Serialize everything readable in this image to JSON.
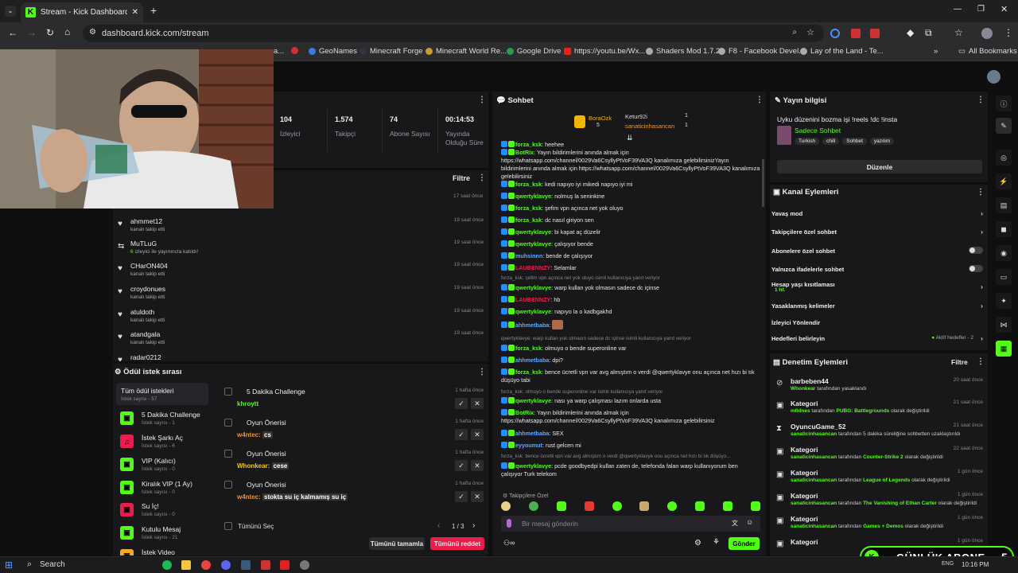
{
  "browser": {
    "tab_title": "Stream - Kick Dashboard",
    "url": "dashboard.kick.com/stream",
    "bookmarks": [
      "a...",
      "GeoNames",
      "Minecraft Forge",
      "Minecraft World Re...",
      "Google Drive",
      "https://youtu.be/Wx...",
      "Shaders Mod 1.7.2",
      "F8 - Facebook Devel...",
      "Lay of the Land - Te..."
    ],
    "all_bookmarks": "All Bookmarks"
  },
  "stats": [
    {
      "value": "104",
      "label": "İzleyici"
    },
    {
      "value": "1.574",
      "label": "Takipçi"
    },
    {
      "value": "74",
      "label": "Abone Sayısı"
    },
    {
      "value": "00:14:53",
      "label": "Yayında Olduğu Süre"
    }
  ],
  "activity": {
    "filter_label": "Filtre",
    "first_time": "17 saat önce",
    "items": [
      {
        "name": "ahmmet12",
        "desc": "kanalı takip etti",
        "time": "19 saat önce",
        "icon": "heart-icon"
      },
      {
        "name": "MuTLuG",
        "desc_count": "6",
        "desc": "izleyici ile yayınınıza katıldı!",
        "time": "19 saat önce",
        "icon": "raid-icon"
      },
      {
        "name": "CHarON404",
        "desc": "kanalı takip etti",
        "time": "19 saat önce",
        "icon": "heart-icon"
      },
      {
        "name": "croydonues",
        "desc": "kanalı takip etti",
        "time": "19 saat önce",
        "icon": "heart-icon"
      },
      {
        "name": "atuldoth",
        "desc": "kanalı takip etti",
        "time": "19 saat önce",
        "icon": "heart-icon"
      },
      {
        "name": "atandgala",
        "desc": "kanalı takip etti",
        "time": "19 saat önce",
        "icon": "heart-icon"
      },
      {
        "name": "radar0212",
        "desc": "",
        "time": "19 saat önce",
        "icon": "heart-icon"
      }
    ]
  },
  "rewards": {
    "title": "Ödül istek sırası",
    "categories": [
      {
        "label": "Tüm ödül istekleri",
        "count": "İstek sayısı - 57"
      },
      {
        "label": "5 Dakika Challenge",
        "count": "İstek sayısı - 1"
      },
      {
        "label": "İstek Şarkı Aç",
        "count": "İstek sayısı - 6"
      },
      {
        "label": "VIP (Kalıcı)",
        "count": "İstek sayısı - 0"
      },
      {
        "label": "Kiralık VIP (1 Ay)",
        "count": "İstek sayısı - 0"
      },
      {
        "label": "Su İç!",
        "count": "İstek sayısı - 0"
      },
      {
        "label": "Kutulu Mesaj",
        "count": "İstek sayısı - 21"
      },
      {
        "label": "İstek Video",
        "count": ""
      }
    ],
    "requests": [
      {
        "title": "5 Dakika Challenge",
        "user": "khroytt",
        "text": "",
        "time": "1 hafta önce"
      },
      {
        "title": "Oyun Önerisi",
        "user": "w4ntec",
        "text": "cs",
        "time": "1 hafta önce"
      },
      {
        "title": "Oyun Önerisi",
        "user": "Whonkear",
        "text": "cese",
        "time": "1 hafta önce"
      },
      {
        "title": "Oyun Önerisi",
        "user": "w4ntec",
        "text": "stokta su iç kalmamış su iç",
        "time": "1 hafta önce"
      }
    ],
    "select_all": "Tümünü Seç",
    "page": "1 / 3",
    "approve_all": "Tümünü tamamla",
    "reject_all": "Tümünü reddet"
  },
  "chat": {
    "title": "Sohbet",
    "top_gifters": [
      {
        "name": "BoraOzk",
        "count": "5"
      },
      {
        "name": "Ketur92i",
        "count": "1"
      },
      {
        "name": "sanaticinhasancan",
        "count": "1"
      }
    ],
    "messages": [
      {
        "user": "forza_ksk",
        "text": "heehee"
      },
      {
        "user": "BotRix",
        "text": "Yayın bildirimlerini anında almak için https://whatsapp.com/channel/0029Va6CsyllyPtVoF39VA3Q kanalımıza gelebilirsinizYayın bildirimlerini anında almak için https://whatsapp.com/channel/0029Va6CsyllyPtVoF39VA3Q kanalımıza gelebilirsiniz"
      },
      {
        "user": "forza_ksk",
        "text": "kedi napıyo iyi mikedi napıyo iyi mi"
      },
      {
        "user": "qwertyklavye",
        "text": "nolmuş la seninkine"
      },
      {
        "user": "forza_ksk",
        "text": "şefim vpn açınca net yok oluyo"
      },
      {
        "user": "forza_ksk",
        "text": "dc nasıl giriyon sen"
      },
      {
        "user": "qwertyklavye",
        "text": "bi kapat aç düzelir"
      },
      {
        "user": "qwertyklavye",
        "text": "çalışıyor bende"
      },
      {
        "user": "muhsinnn",
        "text": "bende de çalışıyor"
      },
      {
        "user": "LAUBENNZY",
        "text": "Selamlar"
      },
      {
        "reply": "forza_ksk: şefim vpn açınca net yok oluyo isimli kullanıcıya yanıt veriyor"
      },
      {
        "user": "qwertyklavye",
        "text": "warp kullan yok olmasın sadece dc içinse"
      },
      {
        "user": "LAUBENNZY",
        "text": "hb"
      },
      {
        "user": "qwertyklavye",
        "text": "napıyo la o kadbgakhd"
      },
      {
        "user": "ahhmetbaba",
        "text": ""
      },
      {
        "reply": "qwertyklavye: warp kullan yok olmasın sadece dc içinse isimli kullanıcıya yanıt veriyor"
      },
      {
        "user": "forza_ksk",
        "text": "olmuyo o bende superonline var"
      },
      {
        "user": "ahhmetbaba",
        "text": "dpi?"
      },
      {
        "user": "forza_ksk",
        "text": "bence ücretli vpn var avg almıştım o verdi @qwertyklavye onu açınca net hızı bi tık düşüyo tabi"
      },
      {
        "reply": "forza_ksk: olmuyo o bende superonline var isimli kullanıcıya yanıt veriyor"
      },
      {
        "user": "qwertyklavye",
        "text": "nası ya warp çalışması lazım onlarda usta"
      },
      {
        "user": "BotRix",
        "text": "Yayın bildirimlerini anında almak için https://whatsapp.com/channel/0029Va6CsyllyPtVoF39VA3Q kanalımıza gelebilirsiniz"
      },
      {
        "user": "ahhmetbaba",
        "text": "SEX"
      },
      {
        "user": "eyyoumut",
        "text": "rust gelcen mi"
      },
      {
        "reply": "forza_ksk: bence ücretli vpn var avg almıştım o verdi @qwertyklavye onu açınca net hızı bi tık düşüyo..."
      },
      {
        "user": "qwertyklavye",
        "text": "pcde goodbyedpi kullan zaten de, telefonda falan warp kullanıyorum ben çalışıyor Turk telekom"
      }
    ],
    "emote_section": "Takipçilere Özel",
    "input_placeholder": "Bir mesaj gönderin",
    "send_label": "Gönder"
  },
  "stream_info": {
    "title": "Yayın bilgisi",
    "stream_title": "Uyku düzenini bozma işi !reels !dc !insta",
    "category": "Sadece Sohbet",
    "tags": [
      "Turkish",
      "chill",
      "Sohbet",
      "yazılım"
    ],
    "edit_label": "Düzenle"
  },
  "channel_actions": {
    "title": "Kanal Eylemleri",
    "items": [
      {
        "label": "Yavaş mod",
        "type": "chevron"
      },
      {
        "label": "Takipçilere özel sohbet",
        "type": "chevron"
      },
      {
        "label": "Abonelere özel sohbet",
        "type": "toggle"
      },
      {
        "label": "Yalnızca ifadelerle sohbet",
        "type": "toggle"
      },
      {
        "label": "Hesap yaşı kısıtlaması",
        "sub": "1 hf.",
        "type": "chevron"
      },
      {
        "label": "Yasaklanmış kelimeler",
        "type": "chevron"
      },
      {
        "label": "İzleyici Yönlendir",
        "type": "none"
      },
      {
        "label": "Hedefleri belirleyin",
        "badge": "Aktif hedefler - 2",
        "type": "chevron"
      }
    ]
  },
  "mod_actions": {
    "title": "Denetim Eylemleri",
    "filter_label": "Filtre",
    "items": [
      {
        "actor": "barbeben44",
        "who": "Whonkear",
        "detail": "tarafından yasaklandı",
        "extra": "",
        "suffix": "",
        "time": "20 saat önce",
        "icon": "ban-icon"
      },
      {
        "actor": "Kategori",
        "who": "m0dnes",
        "detail": "tarafından",
        "extra": "PUBG: Battlegrounds",
        "suffix": "olarak değiştirildi",
        "time": "21 saat önce",
        "icon": "category-icon"
      },
      {
        "actor": "OyuncuGame_52",
        "who": "sanaticinhasancan",
        "detail": "tarafından 5 dakika süreliğine sohbetten uzaklaştırıldı",
        "extra": "",
        "suffix": "",
        "time": "21 saat önce",
        "icon": "timeout-icon"
      },
      {
        "actor": "Kategori",
        "who": "sanaticinhasancan",
        "detail": "tarafından",
        "extra": "Counter-Strike 2",
        "suffix": "olarak değiştirildi",
        "time": "22 saat önce",
        "icon": "category-icon"
      },
      {
        "actor": "Kategori",
        "who": "sanaticinhasancan",
        "detail": "tarafından",
        "extra": "League of Legends",
        "suffix": "olarak değiştirildi",
        "time": "1 gün önce",
        "icon": "category-icon"
      },
      {
        "actor": "Kategori",
        "who": "sanaticinhasancan",
        "detail": "tarafından",
        "extra": "The Vanishing of Ethan Carter",
        "suffix": "olarak değiştirildi",
        "time": "1 gün önce",
        "icon": "category-icon"
      },
      {
        "actor": "Kategori",
        "who": "sanaticinhasancan",
        "detail": "tarafından",
        "extra": "Games + Demos",
        "suffix": "olarak değiştirildi",
        "time": "1 gün önce",
        "icon": "category-icon"
      },
      {
        "actor": "Kategori",
        "who": "",
        "detail": "",
        "extra": "",
        "suffix": "",
        "time": "1 gün önce",
        "icon": "category-icon"
      }
    ]
  },
  "overlay": {
    "label": "GÜNLÜK ABONE",
    "count": "5"
  },
  "taskbar": {
    "search": "Search",
    "lang": "ENG",
    "time": "10:16 PM"
  },
  "colors": {
    "accent": "#53fc18",
    "reject": "#e91e4c"
  }
}
